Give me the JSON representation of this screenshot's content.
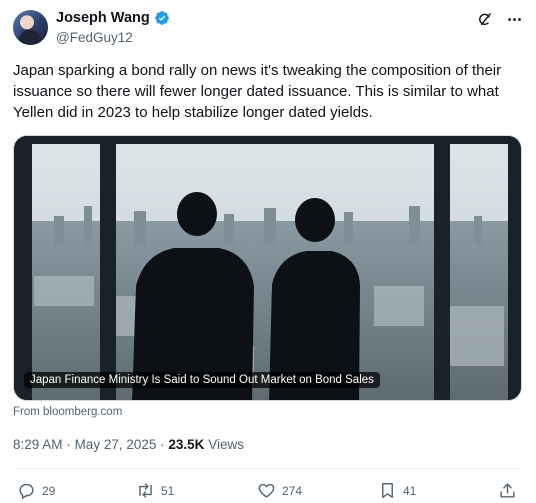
{
  "author": {
    "display_name": "Joseph Wang",
    "handle": "@FedGuy12",
    "verified": true,
    "avatar_icon": "avatar-photo"
  },
  "tweet": {
    "text": "Japan sparking a bond rally on news it's tweaking the composition of their issuance so there will fewer longer dated issuance. This is similar to what Yellen did in 2023 to help stabilize longer dated yields."
  },
  "link_card": {
    "caption": "Japan Finance Ministry Is Said to Sound Out Market on Bond Sales",
    "source": "From bloomberg.com"
  },
  "meta": {
    "time": "8:29 AM",
    "date": "May 27, 2025",
    "views_count": "23.5K",
    "views_label": "Views",
    "separator": "·"
  },
  "actions": {
    "replies": "29",
    "reposts": "51",
    "likes": "274",
    "bookmarks": "41"
  },
  "colors": {
    "text_primary": "#0f1419",
    "text_secondary": "#536471",
    "verified_blue": "#1d9bf0",
    "border": "#cfd9de"
  }
}
